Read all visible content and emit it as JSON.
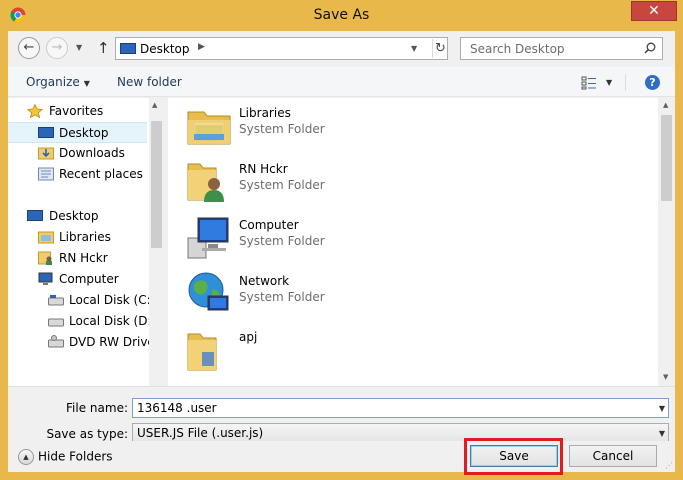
{
  "window": {
    "title": "Save As",
    "close_glyph": "✕",
    "app_icon": "chrome-icon"
  },
  "address": {
    "back_glyph": "←",
    "forward_glyph": "→",
    "up_glyph": "↑",
    "path": "Desktop",
    "refresh_glyph": "↻",
    "search_placeholder": "Search Desktop"
  },
  "toolbar": {
    "organize": "Organize",
    "new_folder": "New folder",
    "help_glyph": "?"
  },
  "nav": {
    "favorites": "Favorites",
    "fav_items": [
      "Desktop",
      "Downloads",
      "Recent places"
    ],
    "desktop": "Desktop",
    "desktop_items": [
      "Libraries",
      "RN Hckr",
      "Computer",
      "Local Disk (C:)",
      "Local Disk (D:)",
      "DVD RW Drive ("
    ]
  },
  "files": [
    {
      "name": "Libraries",
      "type": "System Folder",
      "icon": "libraries-icon"
    },
    {
      "name": "RN Hckr",
      "type": "System Folder",
      "icon": "user-folder-icon"
    },
    {
      "name": "Computer",
      "type": "System Folder",
      "icon": "computer-icon"
    },
    {
      "name": "Network",
      "type": "System Folder",
      "icon": "network-icon"
    },
    {
      "name": "apj",
      "type": "",
      "icon": "folder-icon"
    }
  ],
  "form": {
    "filename_label": "File name:",
    "filename_value": "136148 .user",
    "type_label": "Save as type:",
    "type_value": "USER.JS File (.user.js)"
  },
  "footer": {
    "hide_folders": "Hide Folders",
    "save": "Save",
    "cancel": "Cancel"
  },
  "colors": {
    "title_bar": "#e9b84a",
    "close": "#c7463d",
    "highlight": "#e01c22",
    "selection": "#e5f3fb"
  }
}
